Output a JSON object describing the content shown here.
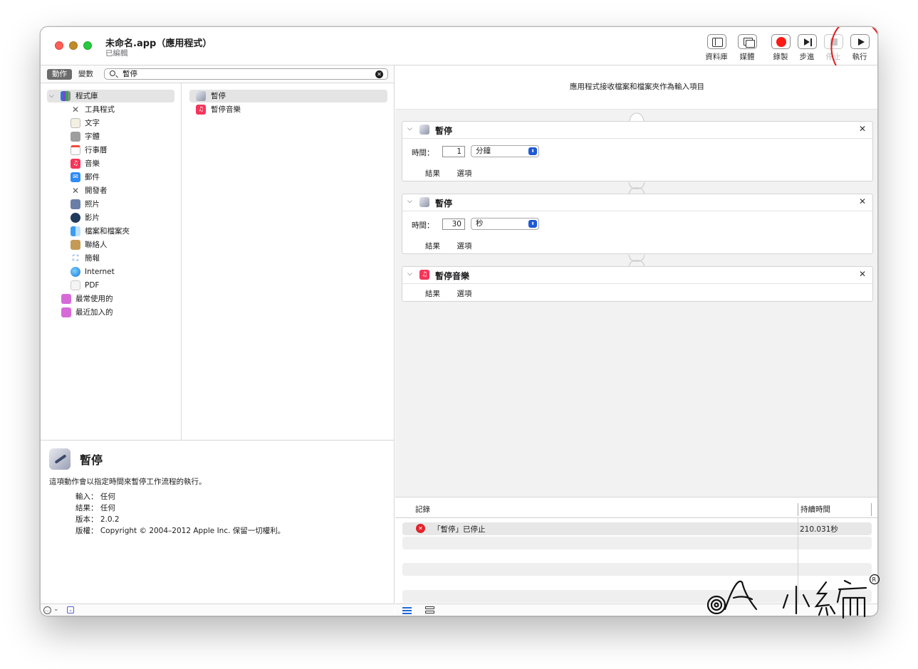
{
  "window": {
    "title": "未命名.app（應用程式）",
    "subtitle": "已編輯"
  },
  "toolbar": {
    "library": "資料庫",
    "media": "媒體",
    "record": "錄製",
    "step": "步進",
    "stop": "停止",
    "run": "執行",
    "record_color": "#fe1a14"
  },
  "left": {
    "tabs": {
      "actions": "動作",
      "variables": "變數"
    },
    "search": {
      "value": "暫停"
    },
    "library": {
      "root": "程式庫",
      "items": [
        "工具程式",
        "文字",
        "字體",
        "行事曆",
        "音樂",
        "郵件",
        "開發者",
        "照片",
        "影片",
        "檔案和檔案夾",
        "聯絡人",
        "簡報",
        "Internet",
        "PDF"
      ],
      "most_used": "最常使用的",
      "recently_added": "最近加入的"
    },
    "actions": [
      "暫停",
      "暫停音樂"
    ],
    "description": {
      "title": "暫停",
      "text": "這項動作會以指定時間來暫停工作流程的執行。",
      "input_label": "輸入：",
      "input_value": "任何",
      "result_label": "結果：",
      "result_value": "任何",
      "version_label": "版本：",
      "version_value": "2.0.2",
      "copyright_label": "版權：",
      "copyright_value": "Copyright © 2004–2012 Apple Inc. 保留一切權利。"
    }
  },
  "workflow": {
    "input_desc": "應用程式接收檔案和檔案夾作為輸入項目",
    "actions": [
      {
        "title": "暫停",
        "time_label": "時間：",
        "value": "1",
        "unit": "分鐘",
        "results": "結果",
        "options": "選項"
      },
      {
        "title": "暫停",
        "time_label": "時間：",
        "value": "30",
        "unit": "秒",
        "results": "結果",
        "options": "選項"
      },
      {
        "title": "暫停音樂",
        "results": "結果",
        "options": "選項"
      }
    ]
  },
  "log": {
    "col_log": "記錄",
    "col_duration": "持續時間",
    "rows": [
      {
        "message": "「暫停」已停止",
        "duration": "210.031秒"
      }
    ]
  },
  "colors": {
    "accent": "#1e5ad6",
    "error": "#e2222c",
    "annotation_circle": "#e01a1a"
  }
}
